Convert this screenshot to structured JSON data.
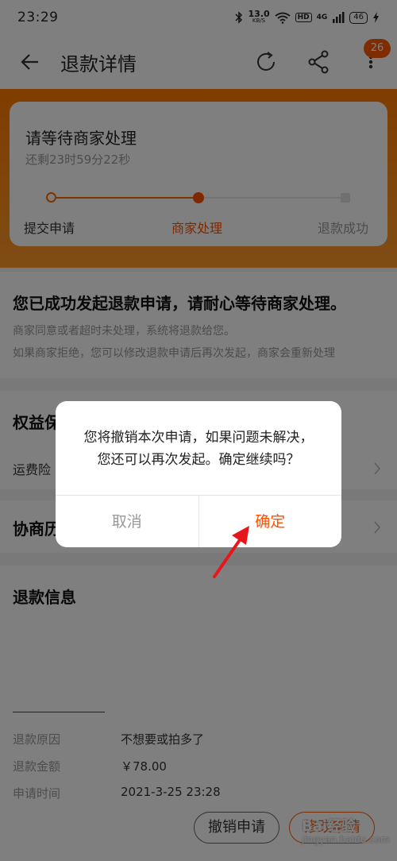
{
  "status_bar": {
    "time": "23:29",
    "network_speed_value": "13.0",
    "network_speed_unit": "KB/S",
    "hd_label": "HD",
    "signal_label": "4G",
    "battery": "46"
  },
  "nav": {
    "title": "退款详情",
    "badge_count": "26"
  },
  "status_card": {
    "title": "请等待商家处理",
    "countdown": "还剩23时59分22秒",
    "steps": [
      {
        "label": "提交申请"
      },
      {
        "label": "商家处理"
      },
      {
        "label": "退款成功"
      }
    ],
    "current_step_index": 1
  },
  "notice": {
    "title": "您已成功发起退款申请，请耐心等待商家处理。",
    "line1": "商家同意或者超时未处理，系统将退款给您。",
    "line2": "如果商家拒绝，您可以修改退款申请后再次发起，商家会重新处理"
  },
  "rights": {
    "title": "权益保",
    "subtitle": "运费险"
  },
  "history": {
    "title": "协商历"
  },
  "refund_info": {
    "title": "退款信息",
    "rows": [
      {
        "key": "退款原因",
        "value": "不想要或拍多了"
      },
      {
        "key": "退款金额",
        "value": "￥78.00"
      },
      {
        "key": "申请时间",
        "value": "2021-3-25 23:28"
      }
    ]
  },
  "bottom_buttons": {
    "cancel_request": "撤销申请",
    "modify_request": "修改申请"
  },
  "dialog": {
    "line1": "您将撤销本次申请，如果问题未解决，",
    "line2": "您还可以再次发起。确定继续吗？",
    "cancel": "取消",
    "confirm": "确定"
  },
  "watermark": {
    "brand": "Bai经验",
    "url": "jingyan.baidu.com"
  },
  "colors": {
    "accent": "#ff5000",
    "hero_gradient_top": "#ff7a00",
    "annotation_arrow": "#e8161b"
  }
}
